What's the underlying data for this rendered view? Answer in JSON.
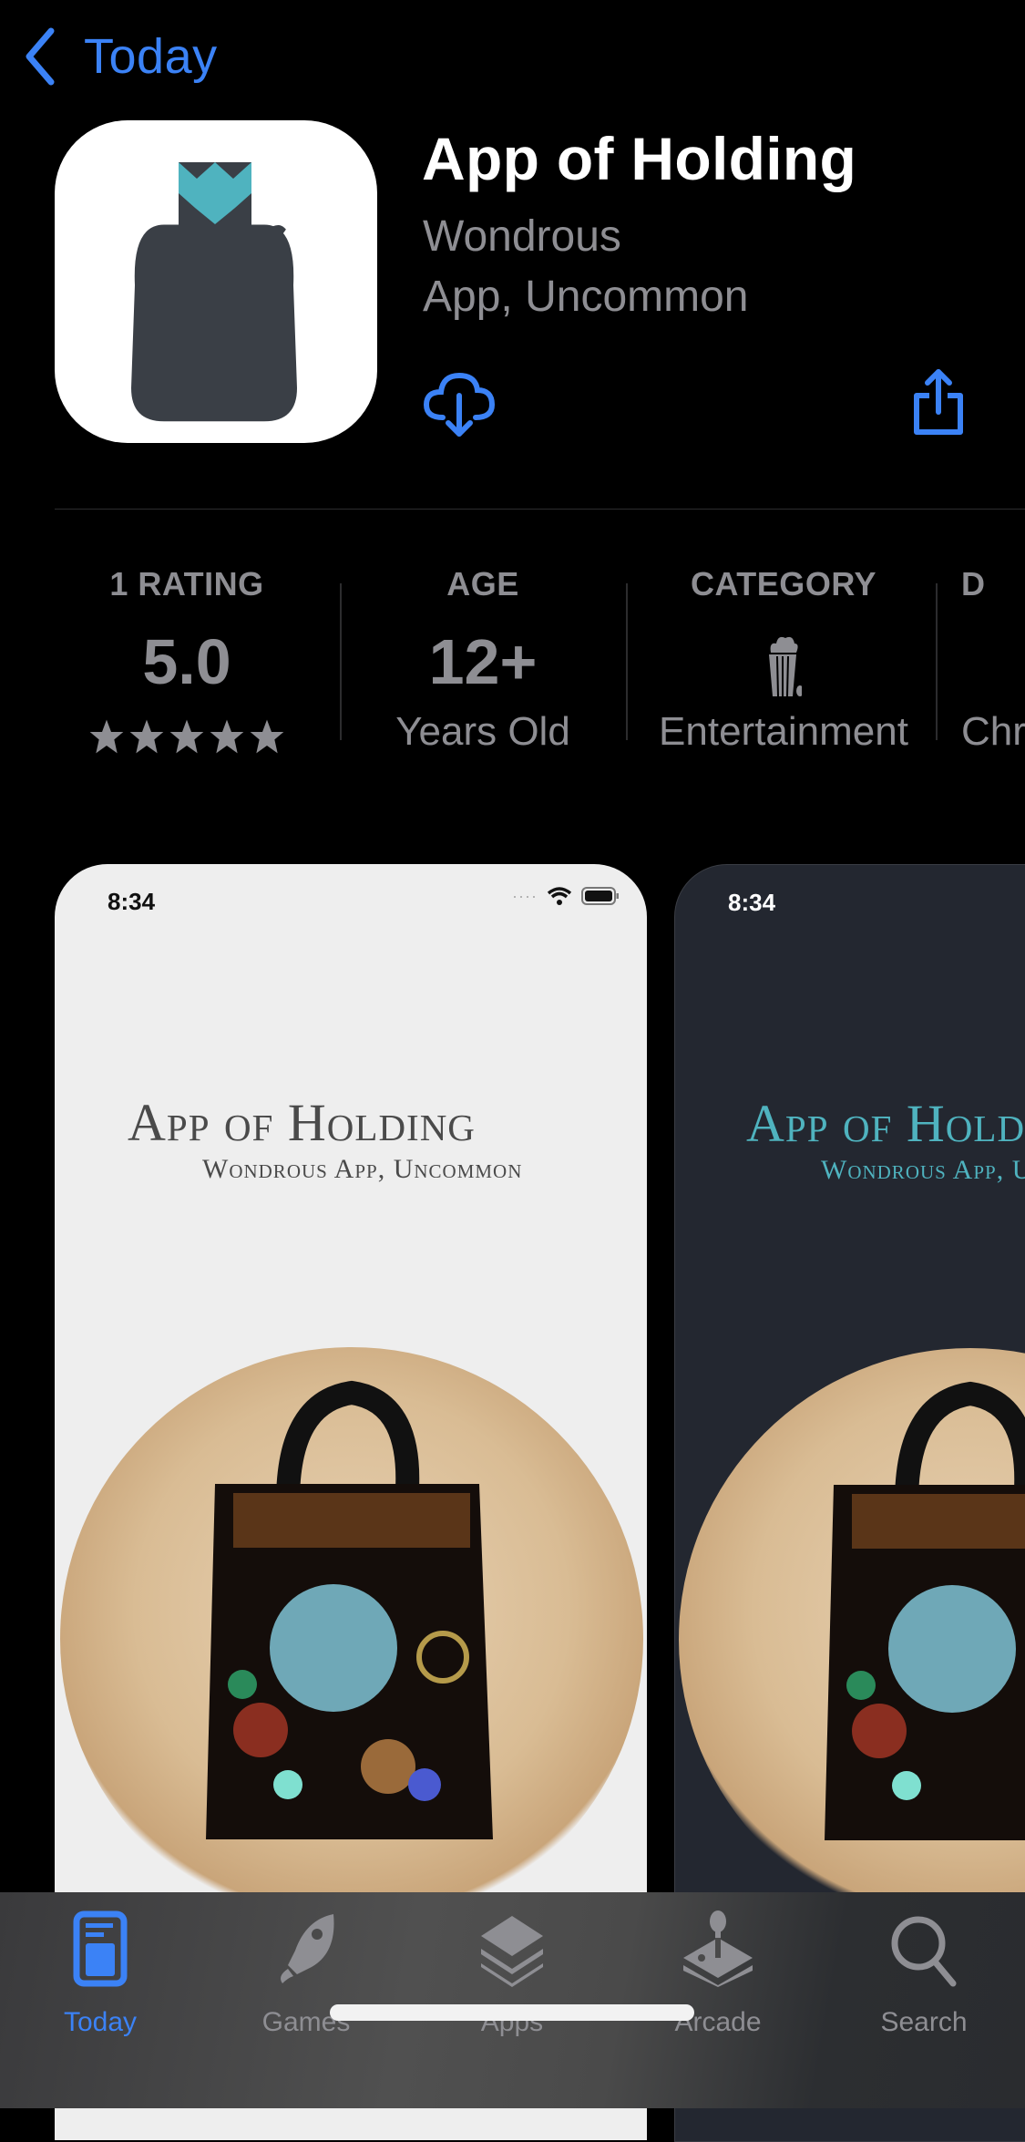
{
  "nav": {
    "back_label": "Today"
  },
  "app": {
    "name": "App of Holding",
    "subtitle_line1": "Wondrous",
    "subtitle_line2": "App, Uncommon",
    "accent_color": "#3b82f6",
    "icon_colors": {
      "bag": "#3a3f46",
      "star": "#4fb3bf",
      "background": "#ffffff"
    }
  },
  "actions": {
    "download_icon": "icloud-download-icon",
    "share_icon": "share-icon"
  },
  "stats": [
    {
      "label": "1 RATING",
      "value": "5.0",
      "footer_type": "stars",
      "stars": 5
    },
    {
      "label": "AGE",
      "value": "12+",
      "footer": "Years Old"
    },
    {
      "label": "CATEGORY",
      "value_icon": "popcorn-icon",
      "footer": "Entertainment"
    },
    {
      "label": "D",
      "footer": "Chr"
    }
  ],
  "screenshots": [
    {
      "theme": "light",
      "status_time": "8:34",
      "title": "App of Holding",
      "subtitle": "Wondrous App, Uncommon"
    },
    {
      "theme": "dark",
      "status_time": "8:34",
      "title": "App of Holding",
      "subtitle": "Wondrous App, Uncommon"
    }
  ],
  "tabbar": {
    "items": [
      {
        "label": "Today",
        "icon": "today-icon",
        "active": true
      },
      {
        "label": "Games",
        "icon": "rocket-icon",
        "active": false
      },
      {
        "label": "Apps",
        "icon": "layers-icon",
        "active": false
      },
      {
        "label": "Arcade",
        "icon": "joystick-icon",
        "active": false
      },
      {
        "label": "Search",
        "icon": "search-icon",
        "active": false
      }
    ]
  }
}
